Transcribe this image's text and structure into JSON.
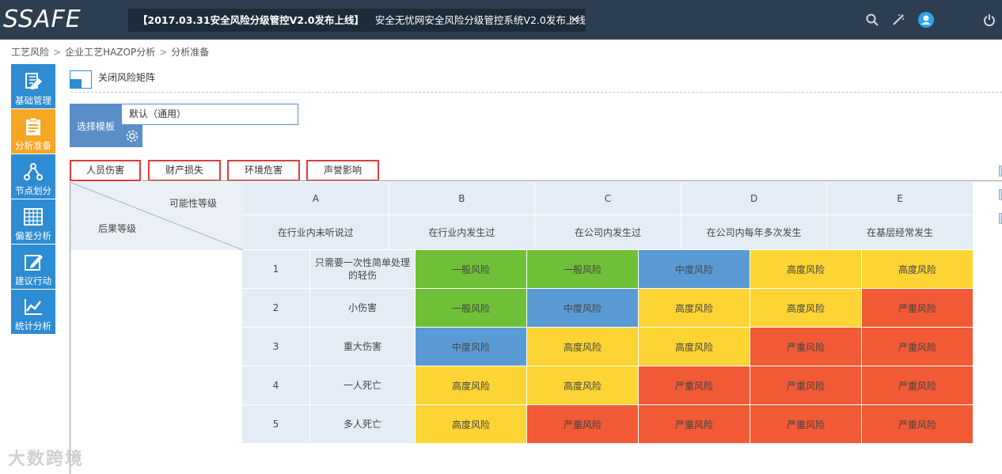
{
  "header": {
    "logo_text": "SSAFE",
    "notice_bold": "【2017.03.31安全风险分级管控V2.0发布上线】",
    "notice_text": "安全无忧网安全风险分级管控系统V2.0发布上线",
    "close_glyph": "×"
  },
  "breadcrumb": [
    "工艺风险",
    "企业工艺HAZOP分析",
    "分析准备"
  ],
  "breadcrumb_sep": ">",
  "sidebar": [
    {
      "label": "基础管理",
      "icon": "document-icon"
    },
    {
      "label": "分析准备",
      "icon": "clipboard-icon"
    },
    {
      "label": "节点划分",
      "icon": "nodes-icon"
    },
    {
      "label": "偏差分析",
      "icon": "grid-icon"
    },
    {
      "label": "建议行动",
      "icon": "edit-icon"
    },
    {
      "label": "统计分析",
      "icon": "chart-icon"
    }
  ],
  "toggle_label": "关闭风险矩阵",
  "template": {
    "label": "选择模板",
    "value": "默认（通用）"
  },
  "tabs": [
    "人员伤害",
    "财产损失",
    "环境危害",
    "声誉影响"
  ],
  "matrix": {
    "possibility_label": "可能性等级",
    "consequence_label": "后果等级",
    "columns": [
      {
        "code": "A",
        "desc": "在行业内未听说过"
      },
      {
        "code": "B",
        "desc": "在行业内发生过"
      },
      {
        "code": "C",
        "desc": "在公司内发生过"
      },
      {
        "code": "D",
        "desc": "在公司内每年多次发生"
      },
      {
        "code": "E",
        "desc": "在基层经常发生"
      }
    ],
    "rows": [
      {
        "level": "1",
        "desc": "只需要一次性简单处理的轻伤",
        "cells": [
          "一般风险",
          "一般风险",
          "中度风险",
          "高度风险",
          "高度风险"
        ]
      },
      {
        "level": "2",
        "desc": "小伤害",
        "cells": [
          "一般风险",
          "中度风险",
          "高度风险",
          "高度风险",
          "严重风险"
        ]
      },
      {
        "level": "3",
        "desc": "重大伤害",
        "cells": [
          "中度风险",
          "高度风险",
          "高度风险",
          "严重风险",
          "严重风险"
        ]
      },
      {
        "level": "4",
        "desc": "一人死亡",
        "cells": [
          "高度风险",
          "高度风险",
          "严重风险",
          "严重风险",
          "严重风险"
        ]
      },
      {
        "level": "5",
        "desc": "多人死亡",
        "cells": [
          "高度风险",
          "严重风险",
          "严重风险",
          "严重风险",
          "严重风险"
        ]
      }
    ],
    "risk_colors": {
      "一般风险": "#6fc037",
      "中度风险": "#5b9bd5",
      "高度风险": "#fcd534",
      "严重风险": "#f15a35"
    }
  },
  "watermark": "大数跨境"
}
